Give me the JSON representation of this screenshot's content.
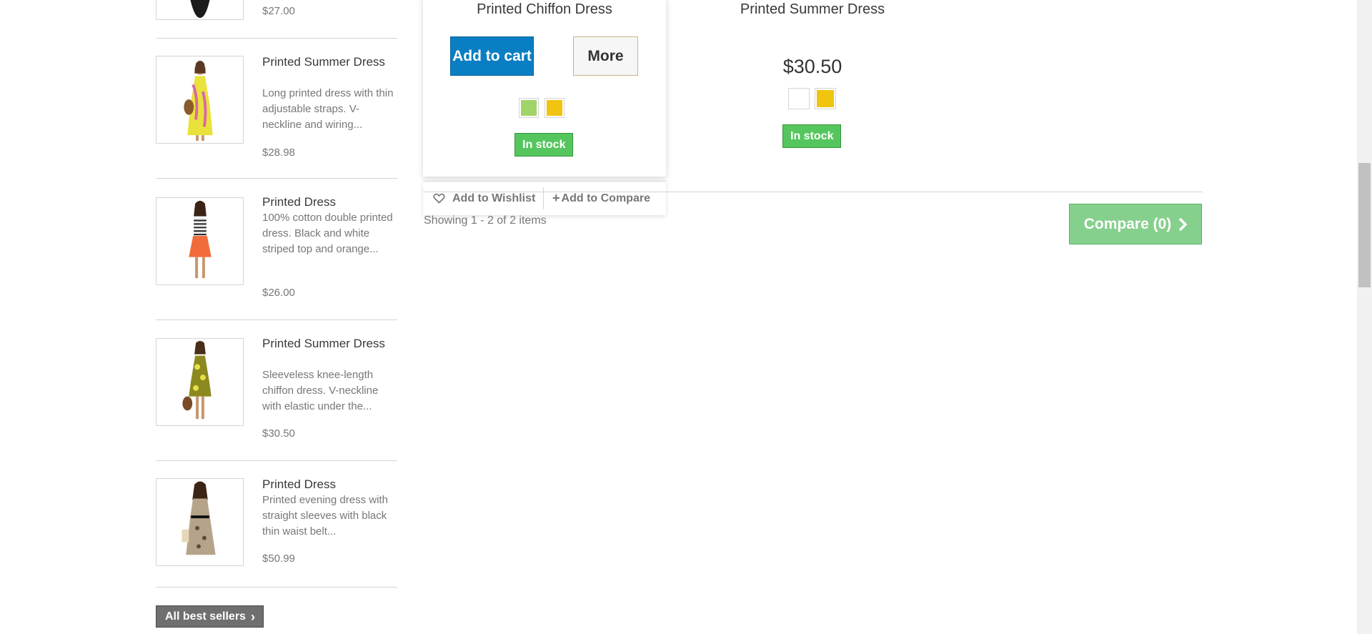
{
  "sidebar": {
    "items": [
      {
        "name": "",
        "description": "",
        "price": "$27.00",
        "image_icon": "dress-black-icon"
      },
      {
        "name": "Printed Summer Dress",
        "description": "Long printed dress with thin adjustable straps. V-neckline and wiring...",
        "price": "$28.98",
        "image_icon": "dress-yellow-long-icon"
      },
      {
        "name": "Printed Dress",
        "description": "100% cotton double printed dress. Black and white striped top and orange...",
        "price": "$26.00",
        "image_icon": "dress-orange-icon"
      },
      {
        "name": "Printed Summer Dress",
        "description": "Sleeveless knee-length chiffon dress. V-neckline with elastic under the...",
        "price": "$30.50",
        "image_icon": "dress-yellow-short-icon"
      },
      {
        "name": "Printed Dress",
        "description": "Printed evening dress with straight sleeves with black thin waist belt...",
        "price": "$50.99",
        "image_icon": "dress-beige-icon"
      }
    ],
    "all_best_sellers_label": "All best sellers"
  },
  "card": {
    "name": "Printed Chiffon Dress",
    "add_to_cart_label": "Add to cart",
    "more_label": "More",
    "colors": [
      "#a0d468",
      "#f1c40f"
    ],
    "stock_label": "In stock",
    "wishlist_label": "Add to Wishlist",
    "compare_label": "Add to Compare"
  },
  "product2": {
    "name": "Printed Summer Dress",
    "price": "$30.50",
    "colors": [
      "#ffffff",
      "#f1c40f"
    ],
    "stock_label": "In stock"
  },
  "listing": {
    "showing_text": "Showing 1 - 2 of 2 items",
    "compare_label": "Compare (0)"
  },
  "colors": {
    "accent_blue": "#0a7ec2",
    "stock_green": "#55c65e",
    "compare_green": "#86d08d"
  }
}
